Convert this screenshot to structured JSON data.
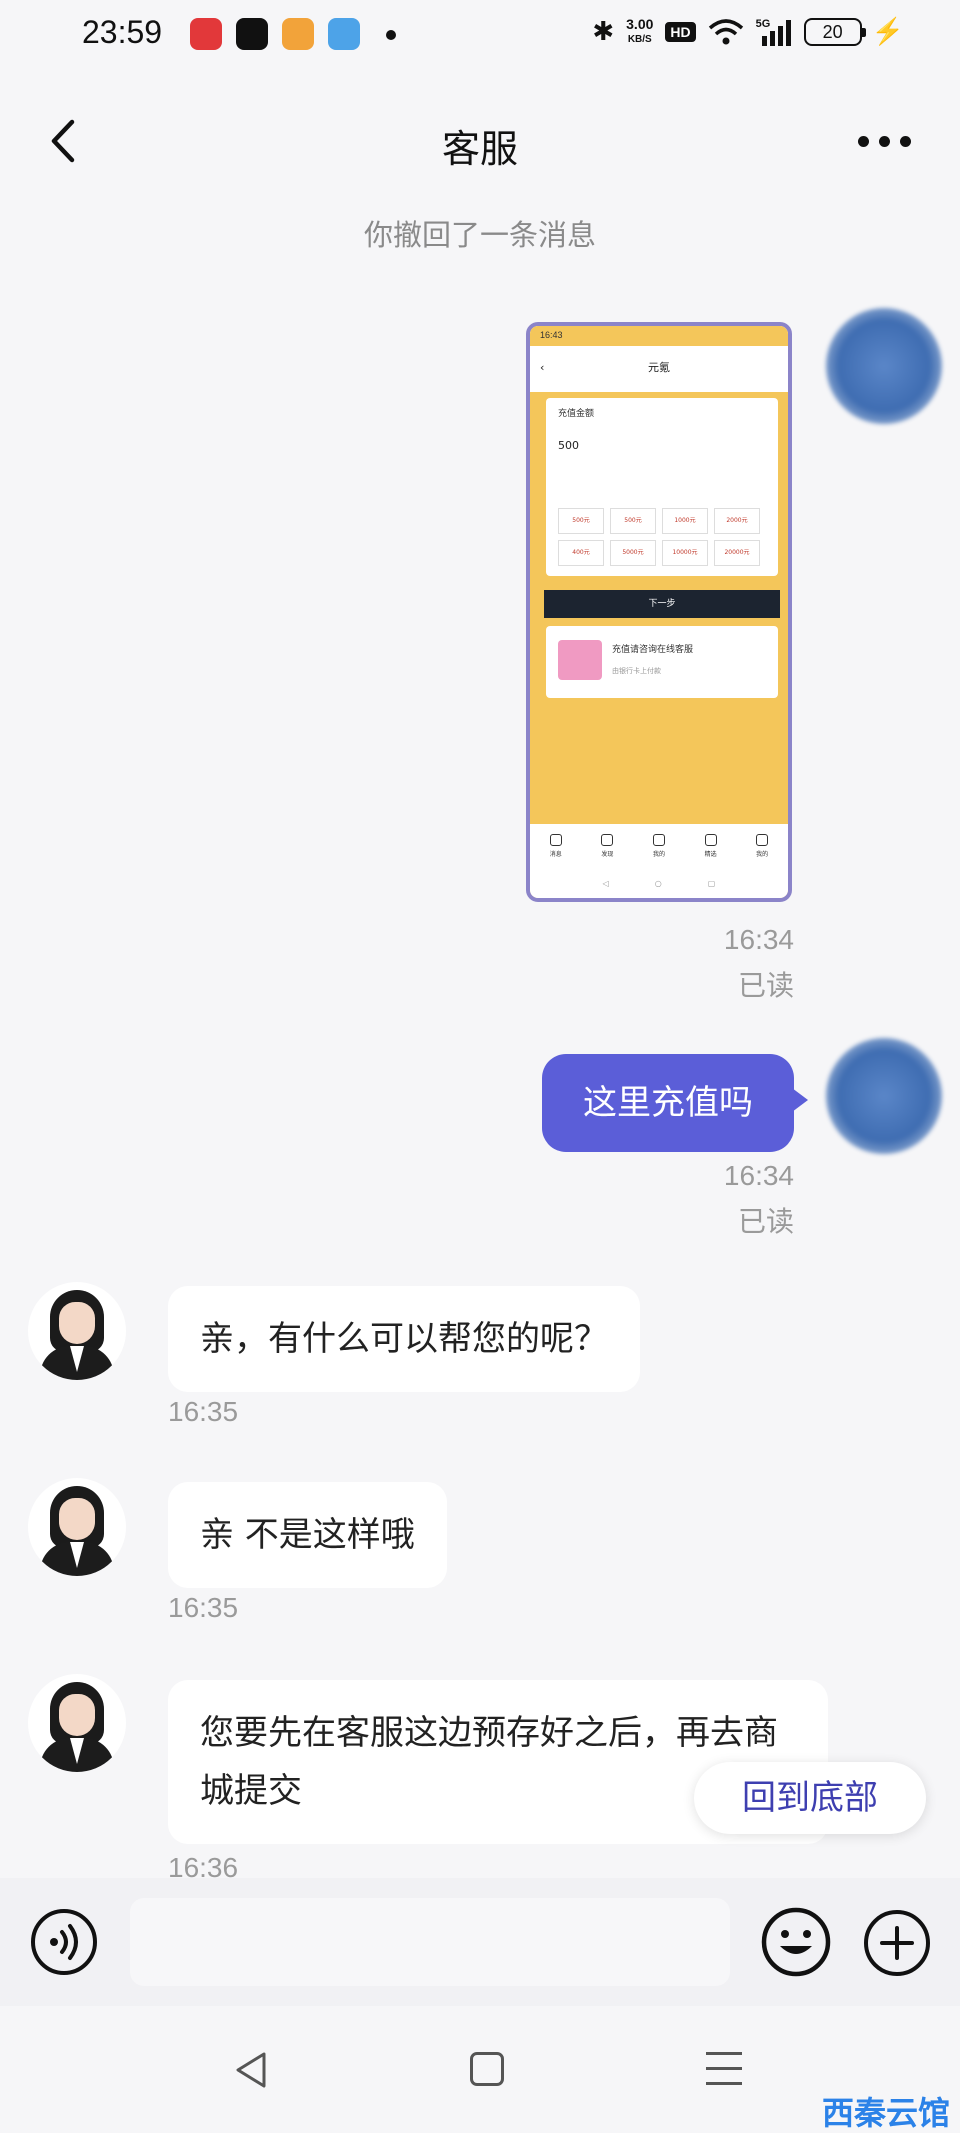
{
  "status_bar": {
    "time": "23:59",
    "speed_value": "3.00",
    "speed_unit": "KB/S",
    "hd": "HD",
    "network": "5G",
    "battery": "20"
  },
  "header": {
    "title": "客服"
  },
  "chat": {
    "system_note": "你撤回了一条消息",
    "screenshot": {
      "status_time": "16:43",
      "nav_title": "元氪",
      "amount_label": "充值金额",
      "amount_value": "500",
      "options": [
        "500元",
        "500元",
        "1000元",
        "2000元",
        "400元",
        "5000元",
        "10000元",
        "20000元"
      ],
      "next_button": "下一步",
      "pay_title": "充值请咨询在线客服",
      "pay_sub": "由银行卡上付款",
      "tabs": [
        "消息",
        "发现",
        "我的",
        "精选",
        "我的"
      ]
    },
    "messages": [
      {
        "sender": "self",
        "type": "image",
        "time": "16:34",
        "status": "已读"
      },
      {
        "sender": "self",
        "type": "text",
        "text": "这里充值吗",
        "time": "16:34",
        "status": "已读"
      },
      {
        "sender": "agent",
        "type": "text",
        "text": "亲，有什么可以帮您的呢？",
        "time": "16:35"
      },
      {
        "sender": "agent",
        "type": "text",
        "text": "亲 不是这样哦",
        "time": "16:35"
      },
      {
        "sender": "agent",
        "type": "text",
        "text": "您要先在客服这边预存好之后，再去商城提交",
        "time": "16:36"
      }
    ],
    "scroll_to_bottom": "回到底部"
  },
  "input_bar": {
    "placeholder": ""
  },
  "watermark": "西秦云馆",
  "colors": {
    "self_bubble": "#5b5ed8",
    "scroll_button_text": "#3e3fb0",
    "watermark": "#2b82e8"
  },
  "icons": [
    "back-icon",
    "more-icon",
    "voice-icon",
    "emoji-icon",
    "plus-icon",
    "nav-back-icon",
    "nav-home-icon",
    "nav-menu-icon"
  ]
}
